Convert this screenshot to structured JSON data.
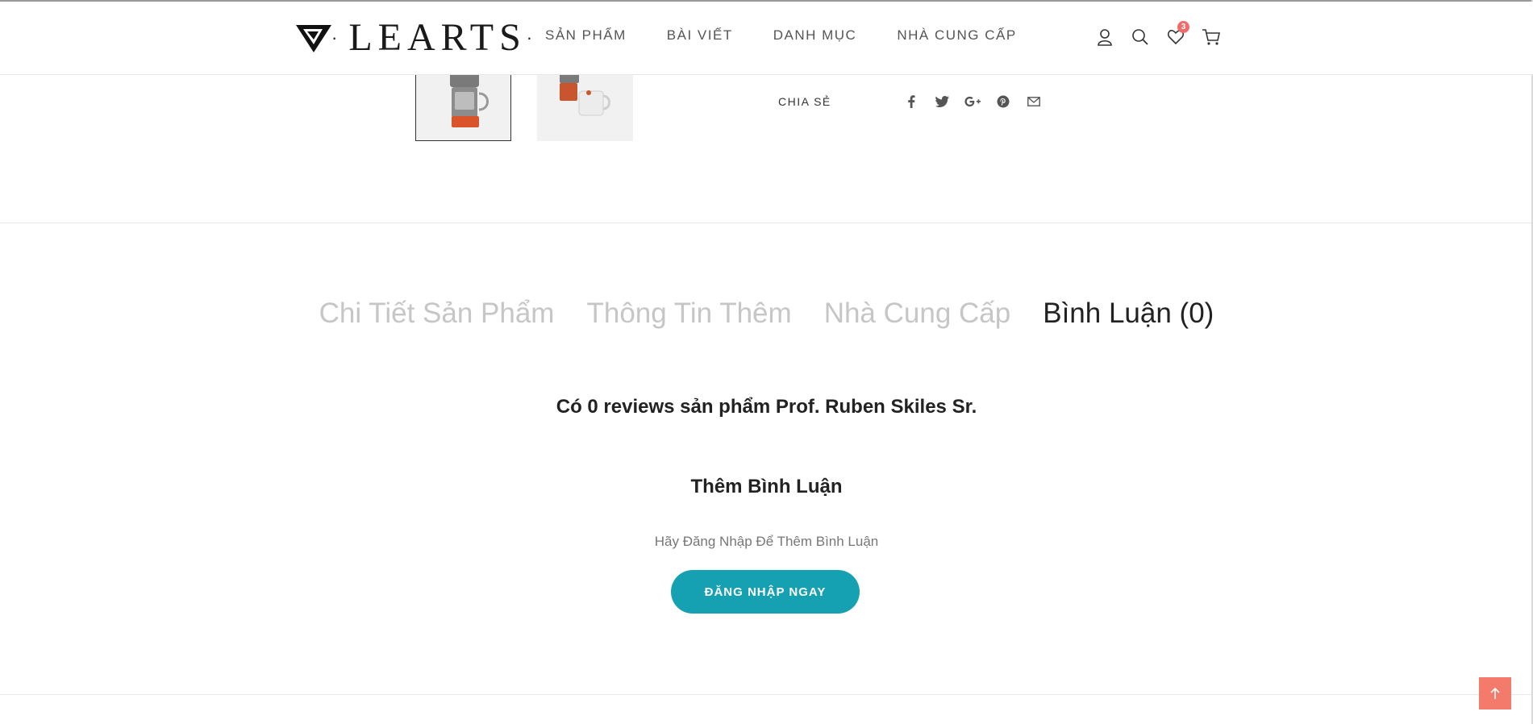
{
  "header": {
    "logo_text": "LEARTS",
    "nav": [
      "SẢN PHẨM",
      "BÀI VIẾT",
      "DANH MỤC",
      "NHÀ CUNG CẤP"
    ],
    "icons": [
      "user-icon",
      "search-icon",
      "heart-icon",
      "cart-icon"
    ],
    "wishlist_count": "3"
  },
  "product": {
    "thumbnails": [
      "coffee-maker-thumbnail",
      "coffee-mug-thumbnail"
    ],
    "share_label": "CHIA SẺ",
    "social_icons": [
      "facebook-icon",
      "twitter-icon",
      "google-plus-icon",
      "pinterest-icon",
      "email-icon"
    ]
  },
  "tabs": [
    "Chi Tiết Sản Phẩm",
    "Thông Tin Thêm",
    "Nhà Cung Cấp",
    "Bình Luận (0)"
  ],
  "active_tab": 3,
  "reviews": {
    "count_text": "Có 0 reviews sản phẩm Prof. Ruben Skiles Sr.",
    "add_title": "Thêm Bình Luận",
    "login_note": "Hãy Đăng Nhập Để Thêm Bình Luận",
    "login_button": "ĐĂNG NHẬP NGAY"
  },
  "colors": {
    "accent": "#16a1b3",
    "scroll_top": "#f47b6c",
    "badge": "#f16b6b"
  }
}
